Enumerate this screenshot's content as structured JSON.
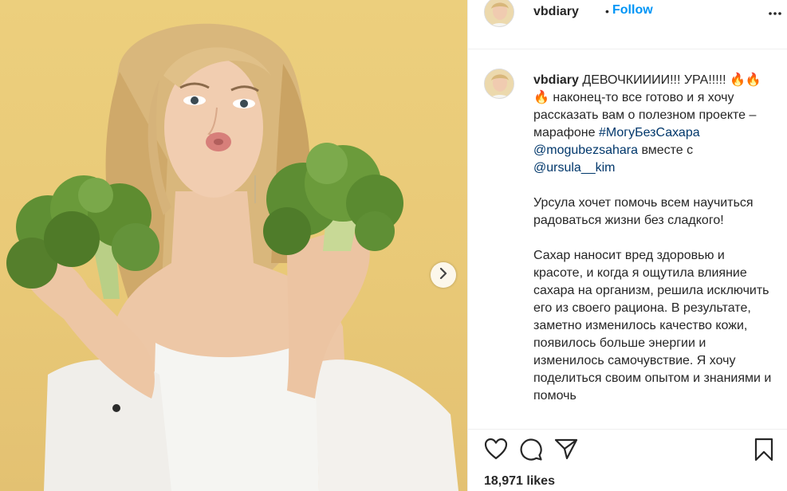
{
  "post": {
    "username": "vbdiary",
    "follow_label": "Follow",
    "separator": "•",
    "icons": {
      "more": "more-options-icon",
      "next": "chevron-right-icon",
      "like": "heart-icon",
      "comment": "comment-icon",
      "share": "paper-plane-icon",
      "save": "bookmark-icon"
    },
    "caption": {
      "username": "vbdiary",
      "p1_text": "ДЕВОЧКИИИИ!!! УРА!!!!! 🔥🔥🔥 наконец-то все готово и я хочу рассказать вам о полезном проекте – марафоне",
      "hashtag": "#МогуБезСахара",
      "mention1": "@mogubezsahara",
      "p1_mid": "вместе с",
      "mention2": "@ursula__kim",
      "p2": "Урсула хочет помочь всем научиться радоваться жизни без сладкого!",
      "p3": "Сахар наносит вред здоровью и красоте, и когда я ощутила влияние сахара на организм, решила исключить его из своего рациона. В результате, заметно изменилось качество кожи, появилось больше энергии и изменилось самочувствие. Я хочу поделиться своим опытом и знаниями и помочь"
    },
    "likes": "18,971 likes",
    "colors": {
      "accent": "#0095f6",
      "link": "#00376b",
      "text": "#262626",
      "background": "#eccf7d"
    }
  }
}
